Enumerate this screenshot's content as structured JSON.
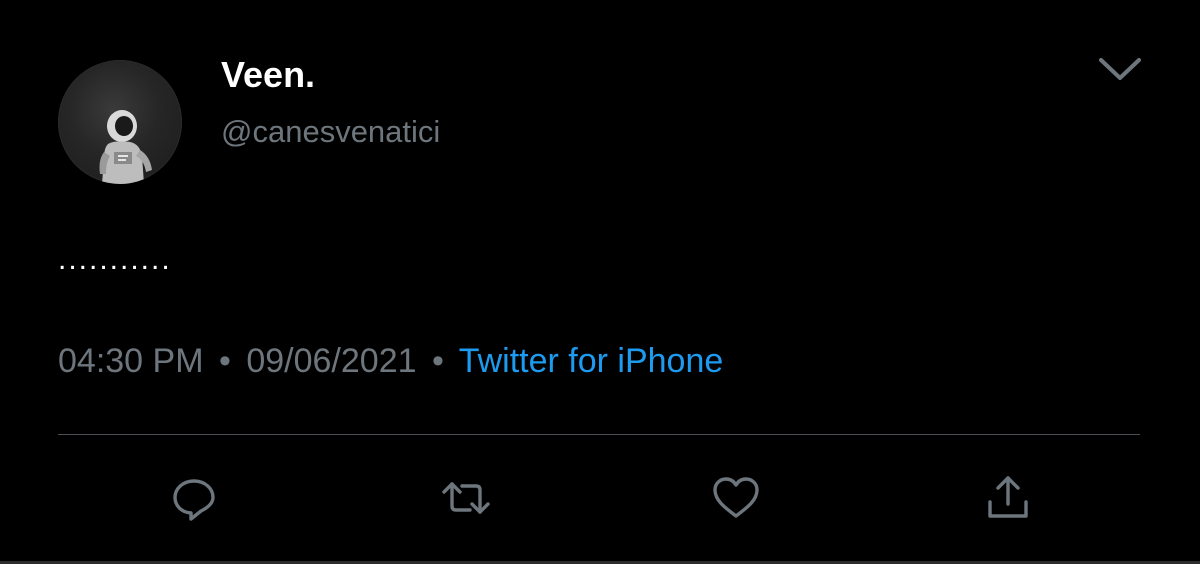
{
  "author": {
    "display_name": "Veen.",
    "handle": "@canesvenatici",
    "avatar_icon": "astronaut-avatar"
  },
  "tweet": {
    "text": "...........",
    "time": "04:30 PM",
    "separator": "•",
    "date": "09/06/2021",
    "source": "Twitter for iPhone"
  },
  "actions": [
    {
      "name": "reply",
      "icon": "reply-icon"
    },
    {
      "name": "retweet",
      "icon": "retweet-icon"
    },
    {
      "name": "like",
      "icon": "heart-icon"
    },
    {
      "name": "share",
      "icon": "share-icon"
    }
  ],
  "menu": {
    "icon": "chevron-down-icon"
  },
  "colors": {
    "background": "#000000",
    "primary_text": "#ffffff",
    "secondary_text": "#6e767d",
    "link": "#1d9bf0",
    "icon": "#6e767d",
    "divider": "#4a4f54"
  }
}
